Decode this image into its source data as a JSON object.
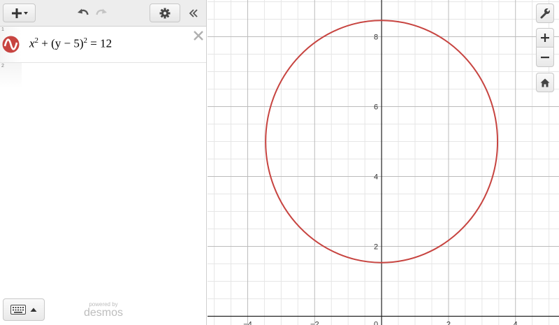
{
  "expression_list": {
    "rows": [
      {
        "number": "1",
        "latex_parts": {
          "x": "x",
          "exp1": "2",
          "mid": " + (y − 5)",
          "exp2": "2",
          "rhs": " = 12"
        },
        "color": "#c74440"
      },
      {
        "number": "2"
      }
    ]
  },
  "footer": {
    "powered_by": "powered by",
    "brand": "desmos"
  },
  "icons": [
    "add-icon",
    "undo-icon",
    "redo-icon",
    "settings-gear-icon",
    "collapse-chevrons-icon",
    "delete-x-icon",
    "keyboard-icon",
    "wrench-icon",
    "zoom-in-icon",
    "zoom-out-icon",
    "home-icon"
  ],
  "graph": {
    "x_range": [
      -5.2,
      5.3
    ],
    "y_range": [
      -0.25,
      9.05
    ],
    "x_ticks": [
      -4,
      -2,
      0,
      2,
      4
    ],
    "y_ticks": [
      2,
      4,
      6,
      8
    ],
    "minor_step": 0.5,
    "curve": {
      "type": "circle",
      "center": [
        0,
        5
      ],
      "radius_squared": 12,
      "color": "#c74440"
    },
    "colors": {
      "minor_grid": "#e6e6e6",
      "major_grid": "#bcbcbc",
      "axis": "#222222"
    }
  }
}
